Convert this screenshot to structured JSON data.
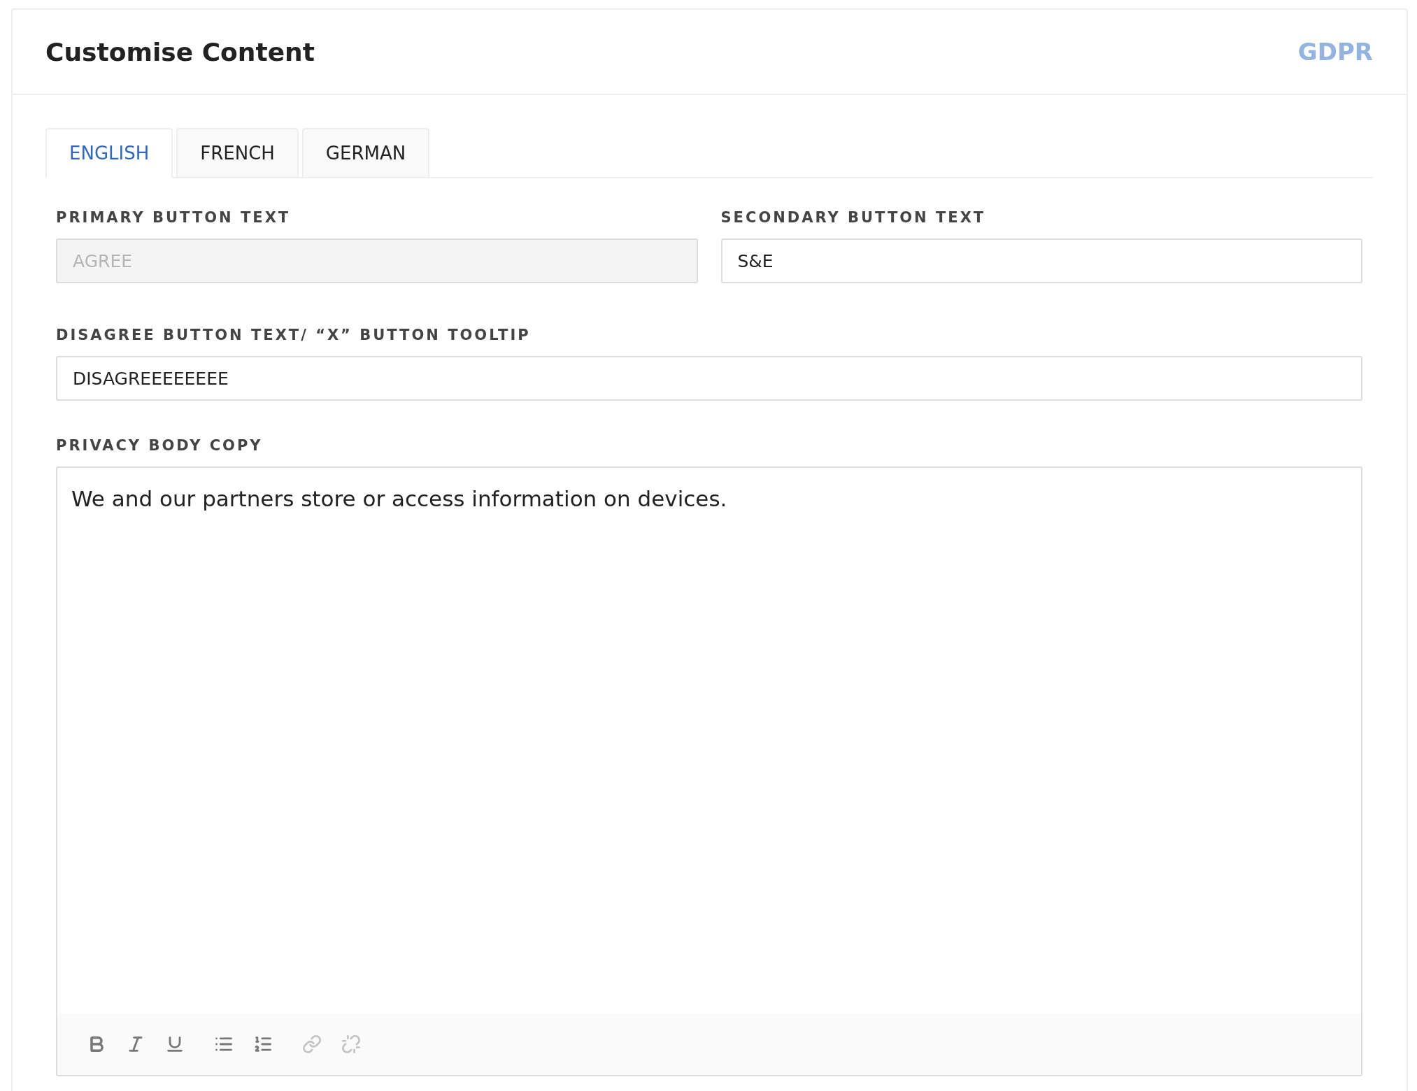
{
  "header": {
    "title": "Customise Content",
    "badge": "GDPR"
  },
  "tabs": [
    {
      "label": "ENGLISH",
      "selected": true
    },
    {
      "label": "FRENCH",
      "selected": false
    },
    {
      "label": "GERMAN",
      "selected": false
    }
  ],
  "fields": [
    {
      "label": "PRIMARY BUTTON TEXT",
      "value": "AGREE",
      "disabled": true
    },
    {
      "label": "SECONDARY BUTTON TEXT",
      "value": "S&E",
      "disabled": false
    },
    {
      "label": "DISAGREE BUTTON TEXT/ “X” BUTTON TOOLTIP",
      "value": "DISAGREEEEEEEE",
      "disabled": false
    }
  ],
  "editor": {
    "label": "PRIVACY BODY COPY",
    "value": "We and our partners store or access information on devices.",
    "toolbar": [
      {
        "kind": "bold",
        "disabled": false
      },
      {
        "kind": "italic",
        "disabled": false
      },
      {
        "kind": "underline",
        "disabled": false
      },
      {
        "kind": "bullet-list",
        "disabled": false
      },
      {
        "kind": "numbered-list",
        "disabled": false
      },
      {
        "kind": "link",
        "disabled": true
      },
      {
        "kind": "unlink",
        "disabled": true
      }
    ]
  }
}
